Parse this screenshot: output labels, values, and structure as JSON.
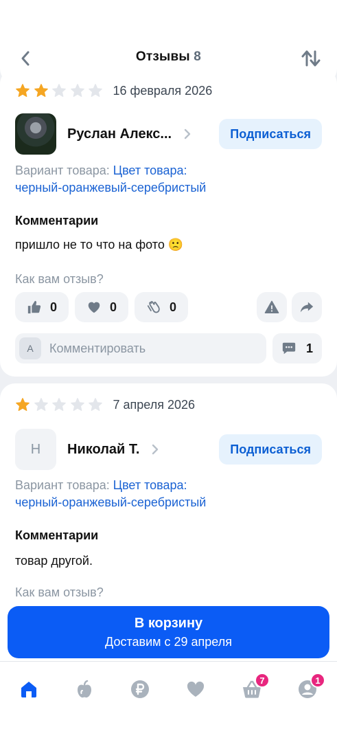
{
  "header": {
    "title": "Отзывы",
    "count": "8",
    "back_icon": "arrow-left-icon",
    "sort_icon": "sort-arrows-icon"
  },
  "colors": {
    "accent": "#0b5cf5",
    "link": "#1a62d3",
    "star_filled": "#f5a623",
    "star_empty": "#e3e6eb",
    "badge": "#e8267e"
  },
  "reviews": [
    {
      "rating": 2,
      "date": "16 февраля 2026",
      "user_name": "Руслан Алекс...",
      "avatar_letter": "",
      "subscribe_label": "Подписаться",
      "variant_label": "Вариант товара:",
      "variant_value_line1": "Цвет товара:",
      "variant_value_line2": "черный-оранжевый-серебристый",
      "comment_title": "Комментарии",
      "comment_text": "пришло не то что на фото 🙁",
      "ask": "Как вам отзыв?",
      "likes": "0",
      "hearts": "0",
      "claps": "0",
      "comment_placeholder": "Комментировать",
      "input_letter": "А",
      "comments_count": "1"
    },
    {
      "rating": 1,
      "date": "7 апреля 2026",
      "user_name": "Николай Т.",
      "avatar_letter": "Н",
      "subscribe_label": "Подписаться",
      "variant_label": "Вариант товара:",
      "variant_value_line1": "Цвет товара:",
      "variant_value_line2": "черный-оранжевый-серебристый",
      "comment_title": "Комментарии",
      "comment_text": "товар другой.",
      "ask": "Как вам отзыв?"
    }
  ],
  "cart": {
    "label": "В корзину",
    "delivery": "Доставим с 29 апреля"
  },
  "tabbar": {
    "items": [
      {
        "icon": "home-icon",
        "badge": ""
      },
      {
        "icon": "apple-icon",
        "badge": ""
      },
      {
        "icon": "ruble-coin-icon",
        "badge": ""
      },
      {
        "icon": "heart-icon",
        "badge": ""
      },
      {
        "icon": "basket-icon",
        "badge": "7"
      },
      {
        "icon": "profile-icon",
        "badge": "1"
      }
    ]
  }
}
